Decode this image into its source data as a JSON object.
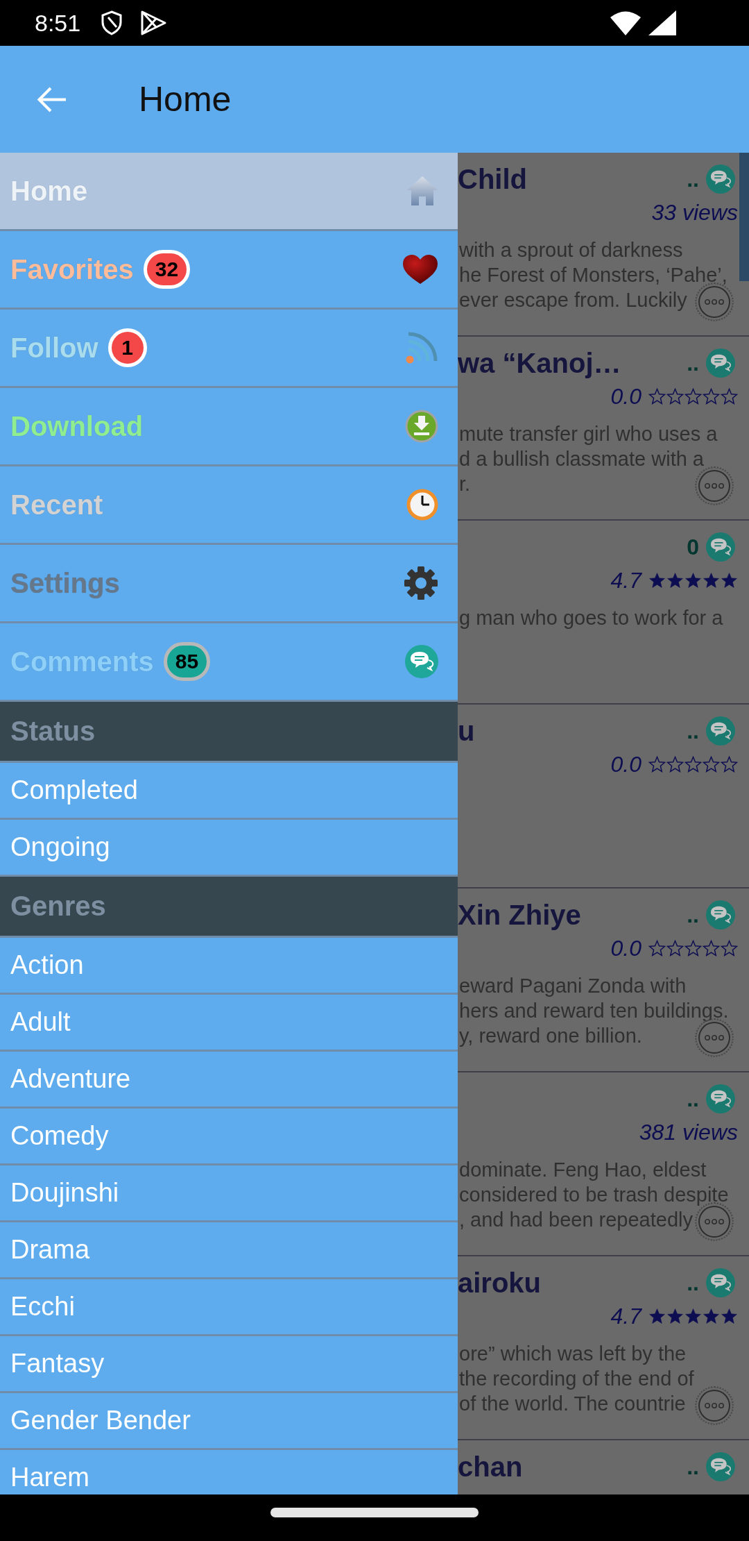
{
  "status_bar": {
    "time": "8:51"
  },
  "app_bar": {
    "title": "Home"
  },
  "drawer": {
    "menu": [
      {
        "label": "Home",
        "selected": true,
        "color": "#eef3f8"
      },
      {
        "label": "Favorites",
        "selected": false,
        "color": "#ffbc9a",
        "badge": {
          "kind": "alert",
          "count": "32"
        }
      },
      {
        "label": "Follow",
        "selected": false,
        "color": "#a9dcec",
        "badge": {
          "kind": "alert",
          "count": "1"
        }
      },
      {
        "label": "Download",
        "selected": false,
        "color": "#90ee90"
      },
      {
        "label": "Recent",
        "selected": false,
        "color": "#d3d3d3"
      },
      {
        "label": "Settings",
        "selected": false,
        "color": "#66778a"
      },
      {
        "label": "Comments",
        "selected": false,
        "color": "#8fd0f8",
        "badge": {
          "kind": "count",
          "count": "85"
        }
      }
    ],
    "sections": [
      {
        "title": "Status",
        "items": [
          {
            "label": "Completed",
            "selected": false
          },
          {
            "label": "Ongoing",
            "selected": false
          }
        ]
      },
      {
        "title": "Genres",
        "items": [
          {
            "label": "Action",
            "selected": false
          },
          {
            "label": "Adult",
            "selected": false
          },
          {
            "label": "Adventure",
            "selected": false
          },
          {
            "label": "Comedy",
            "selected": false
          },
          {
            "label": "Doujinshi",
            "selected": false
          },
          {
            "label": "Drama",
            "selected": false
          },
          {
            "label": "Ecchi",
            "selected": false
          },
          {
            "label": "Fantasy",
            "selected": false
          },
          {
            "label": "Gender Bender",
            "selected": false
          },
          {
            "label": "Harem",
            "selected": false
          }
        ]
      }
    ]
  },
  "content": {
    "cards": [
      {
        "title": "Child",
        "comments": "..",
        "meta": {
          "kind": "views",
          "text": "33 views"
        },
        "description": [
          "with a sprout of darkness",
          "he Forest of Monsters, ‘Pahe’,",
          "ever escape from. Luckily"
        ],
        "more_button": true
      },
      {
        "title": "wa “Kanoj…",
        "comments": "..",
        "meta": {
          "kind": "rating",
          "text": "0.0",
          "stars": 0
        },
        "description": [
          "mute transfer girl who uses a",
          "d a bullish classmate with a",
          "r."
        ],
        "more_button": true
      },
      {
        "comments": "0",
        "meta": {
          "kind": "rating",
          "text": "4.7",
          "stars": 5
        },
        "description": [
          "g man who goes to work for a"
        ],
        "more_button": false
      },
      {
        "title": "u",
        "comments": "..",
        "meta": {
          "kind": "rating",
          "text": "0.0",
          "stars": 0
        },
        "more_button": false
      },
      {
        "title": "Xin Zhiye",
        "comments": "..",
        "meta": {
          "kind": "rating",
          "text": "0.0",
          "stars": 0
        },
        "description": [
          "eward Pagani Zonda with",
          "hers and reward ten buildings.",
          "y, reward one billion."
        ],
        "more_button": true
      },
      {
        "comments": "..",
        "meta": {
          "kind": "views",
          "text": "381 views"
        },
        "description": [
          "dominate. Feng Hao, eldest",
          "considered to be trash despite",
          ", and had been repeatedly"
        ],
        "more_button": true
      },
      {
        "title": "airoku",
        "comments": "..",
        "meta": {
          "kind": "rating",
          "text": "4.7",
          "stars": 5
        },
        "description": [
          "ore” which was left by the",
          "the recording of the end of",
          "of the world. The countrie"
        ],
        "more_button": true
      },
      {
        "title": "chan",
        "comments": ".."
      }
    ]
  }
}
